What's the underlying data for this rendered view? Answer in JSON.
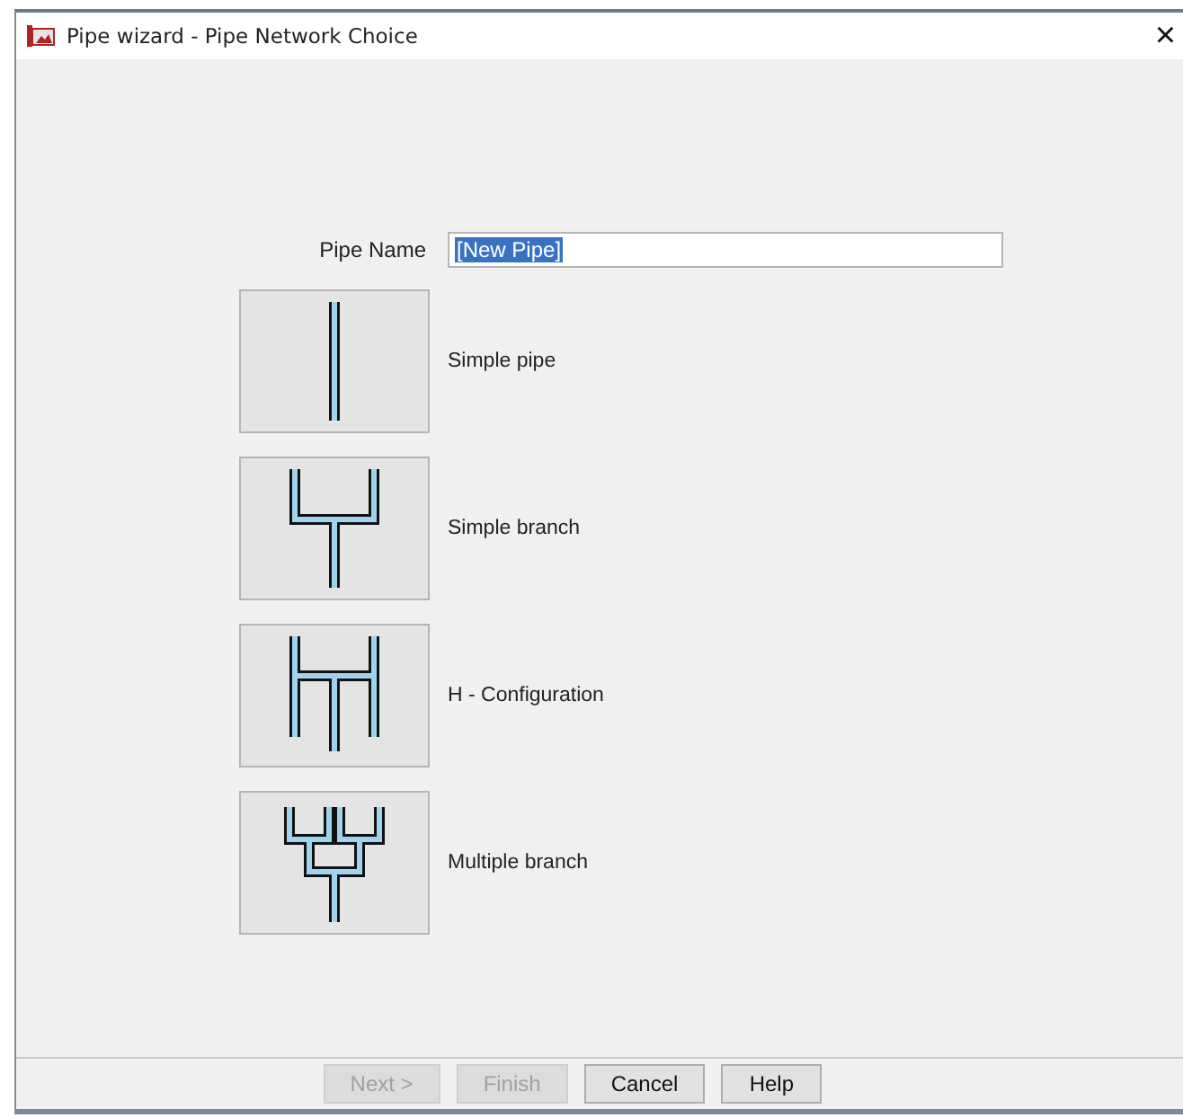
{
  "window": {
    "title": "Pipe wizard - Pipe Network Choice",
    "close": "×"
  },
  "pipe_name": {
    "label": "Pipe Name",
    "value": "[New Pipe]",
    "value_selected": true
  },
  "options": [
    {
      "kind": "simple",
      "label": "Simple pipe"
    },
    {
      "kind": "branch",
      "label": "Simple branch"
    },
    {
      "kind": "h",
      "label": "H - Configuration"
    },
    {
      "kind": "multiple",
      "label": "Multiple branch"
    }
  ],
  "buttons": [
    {
      "label": "Next >",
      "disabled": true
    },
    {
      "label": "Finish",
      "disabled": true
    },
    {
      "label": "Cancel",
      "disabled": false
    },
    {
      "label": "Help",
      "disabled": false
    }
  ]
}
